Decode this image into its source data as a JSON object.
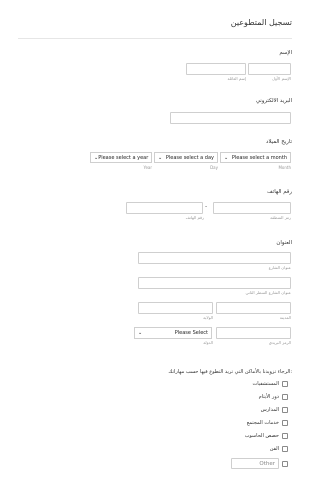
{
  "form": {
    "title": "تسجيل المتطوعين",
    "name": {
      "label": "الإسم",
      "first_sub": "الإسم الأول",
      "last_sub": "إسم العائلة"
    },
    "email": {
      "label": "البريد الالكتروني"
    },
    "dob": {
      "label": "تاريخ الميلاد",
      "year": {
        "value": "Please select a year",
        "sub": "Year"
      },
      "day": {
        "value": "Please select a day",
        "sub": "Day"
      },
      "month": {
        "value": "Please select a month",
        "sub": "Month"
      }
    },
    "phone": {
      "label": "رقم الهاتف",
      "dash": "-",
      "area_sub": "رمز المنطقة",
      "number_sub": "رقم الهاتف"
    },
    "address": {
      "label": "العنوان",
      "street_sub": "عنوان الشارع",
      "street2_sub": "عنوان الشارع السطر الثاني",
      "city_sub": "المدينة",
      "state_sub": "الولاية",
      "zip_sub": "الرمز البريدي",
      "country_value": "Please Select",
      "country_sub": "الدولة"
    },
    "places": {
      "label": "الرجاء تزويدنا بالأماكن التي تريد التطوع فيها حسب مهاراتك:",
      "options": [
        "المستشفيات",
        "دور الأيتام",
        "المدارس",
        "خدمات المجتمع",
        "حصص الحاسوب",
        "الفن"
      ],
      "other_placeholder": "Other"
    }
  }
}
